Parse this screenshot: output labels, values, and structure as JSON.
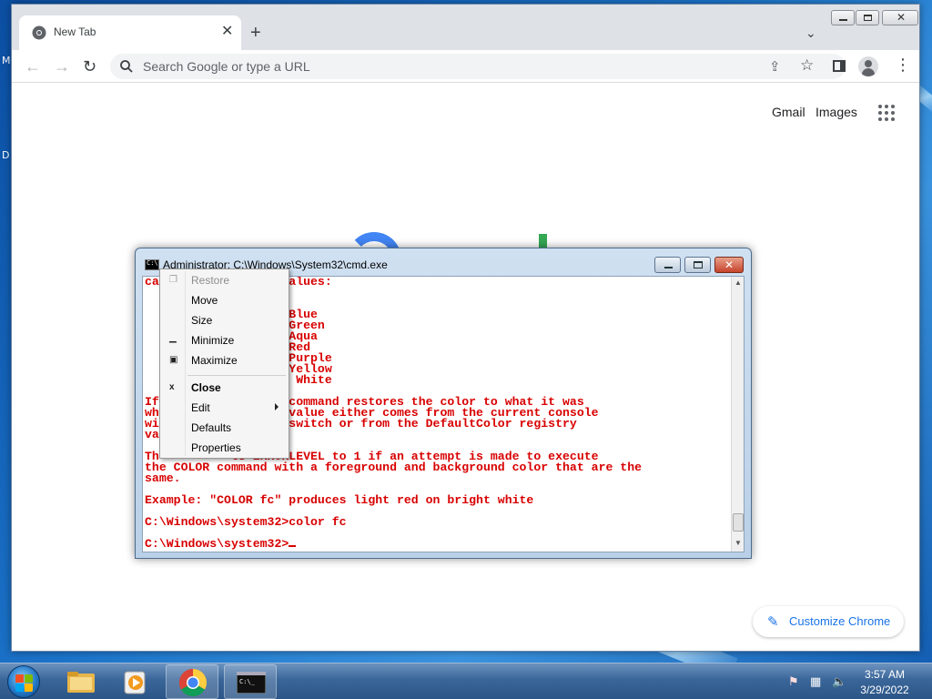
{
  "browser": {
    "tab_title": "New Tab",
    "omnibox_placeholder": "Search Google or type a URL",
    "gmail_link": "Gmail",
    "images_link": "Images",
    "customize_label": "Customize Chrome"
  },
  "cmd": {
    "title": "Administrator: C:\\Windows\\System32\\cmd.exe",
    "lines": [
      "ca         llowing values:",
      "",
      "          8 = Gray",
      "          9 = Light Blue",
      "          A = Light Green",
      "          B = Light Aqua",
      "          C = Light Red",
      "          D = Light Purple",
      "          E = Light Yellow",
      "          F = Bright White",
      "",
      "If        ven, this command restores the color to what it was",
      "wh          .  This value either comes from the current console",
      "wi          nd line switch or from the DefaultColor registry",
      "va",
      "",
      "Th          ts ERRORLEVEL to 1 if an attempt is made to execute",
      "the COLOR command with a foreground and background color that are the",
      "same.",
      "",
      "Example: \"COLOR fc\" produces light red on bright white",
      "",
      "C:\\Windows\\system32>color fc",
      ""
    ],
    "prompt": "C:\\Windows\\system32>"
  },
  "context_menu": {
    "restore": "Restore",
    "move": "Move",
    "size": "Size",
    "minimize": "Minimize",
    "maximize": "Maximize",
    "close": "Close",
    "edit": "Edit",
    "defaults": "Defaults",
    "properties": "Properties"
  },
  "taskbar": {
    "time": "3:57 AM",
    "date": "3/29/2022"
  },
  "desktop": {
    "edge_label_1": "M",
    "edge_label_2": "D"
  },
  "colors": {
    "cmd_text": "#d80000",
    "google_blue": "#4285f4",
    "google_green": "#34a853",
    "accent": "#1a73e8"
  }
}
